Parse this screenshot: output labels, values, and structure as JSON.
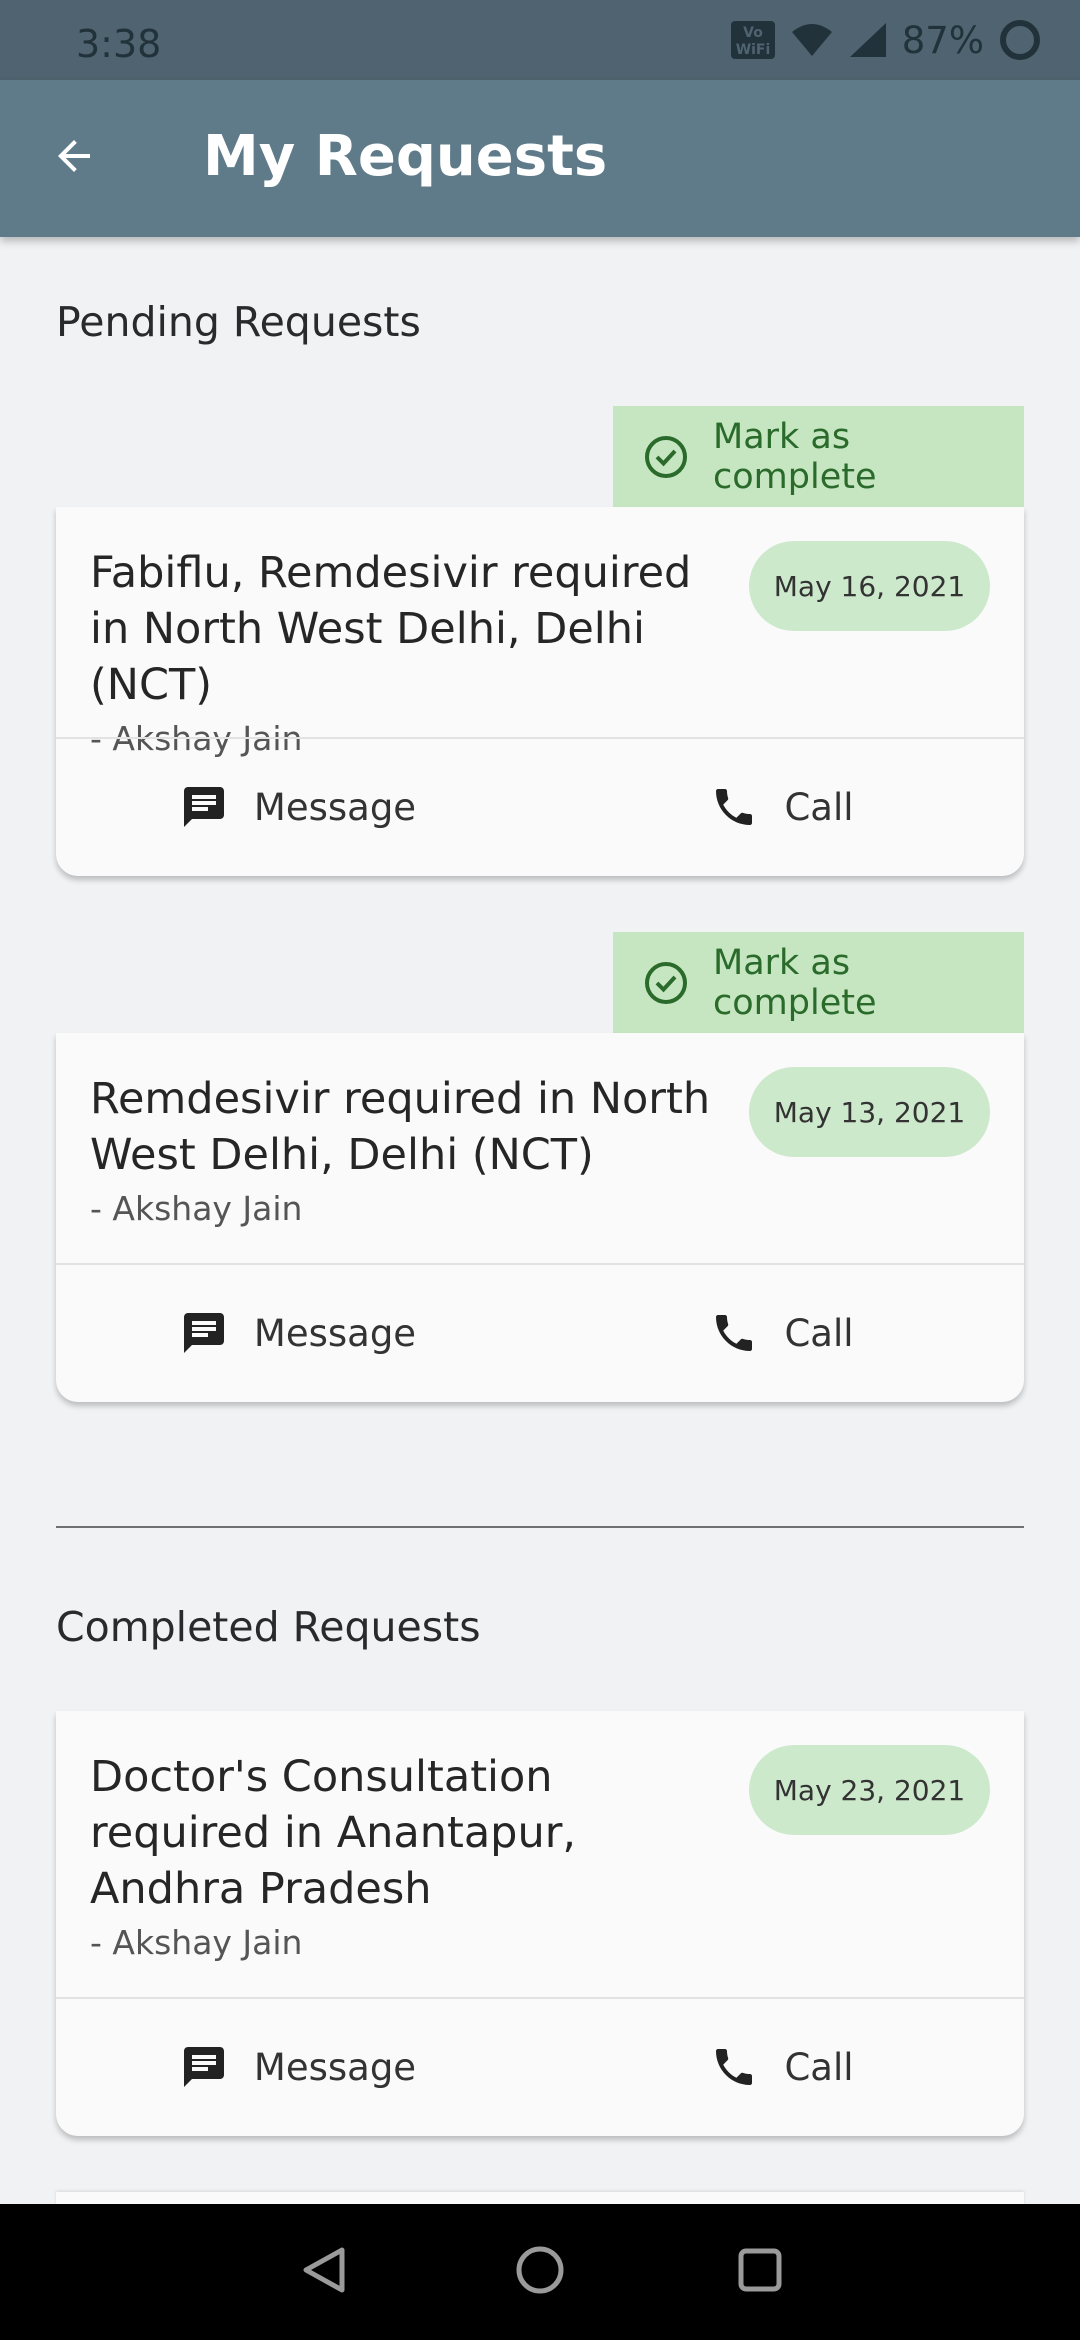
{
  "status_bar": {
    "time": "3:38",
    "battery": "87%",
    "icons": [
      "vowifi-icon",
      "wifi-icon",
      "signal-icon",
      "battery-icon"
    ]
  },
  "app_bar": {
    "title": "My Requests",
    "back_icon": "arrow-back-icon"
  },
  "pending": {
    "title": "Pending Requests",
    "requests": [
      {
        "mark_complete": "Mark as complete",
        "title": "Fabiflu, Remdesivir required in North West Delhi, Delhi (NCT)",
        "author": "- Akshay Jain",
        "date": "May 16, 2021",
        "message": "Message",
        "call": "Call"
      },
      {
        "mark_complete": "Mark as complete",
        "title": "Remdesivir required in North West Delhi, Delhi (NCT)",
        "author": "- Akshay Jain",
        "date": "May 13, 2021",
        "message": "Message",
        "call": "Call"
      }
    ]
  },
  "completed": {
    "title": "Completed Requests",
    "requests": [
      {
        "title": "Doctor's Consultation required in Anantapur, Andhra Pradesh",
        "author": "- Akshay Jain",
        "date": "May 23, 2021",
        "message": "Message",
        "call": "Call"
      }
    ]
  },
  "colors": {
    "app_bar": "#5f7b8a",
    "status_bar": "#4f6470",
    "accent_green": "#c5e6c1",
    "chip_green": "#cde9cc"
  },
  "nav_bar": {
    "icons": [
      "back-triangle-icon",
      "home-circle-icon",
      "recents-square-icon"
    ]
  }
}
